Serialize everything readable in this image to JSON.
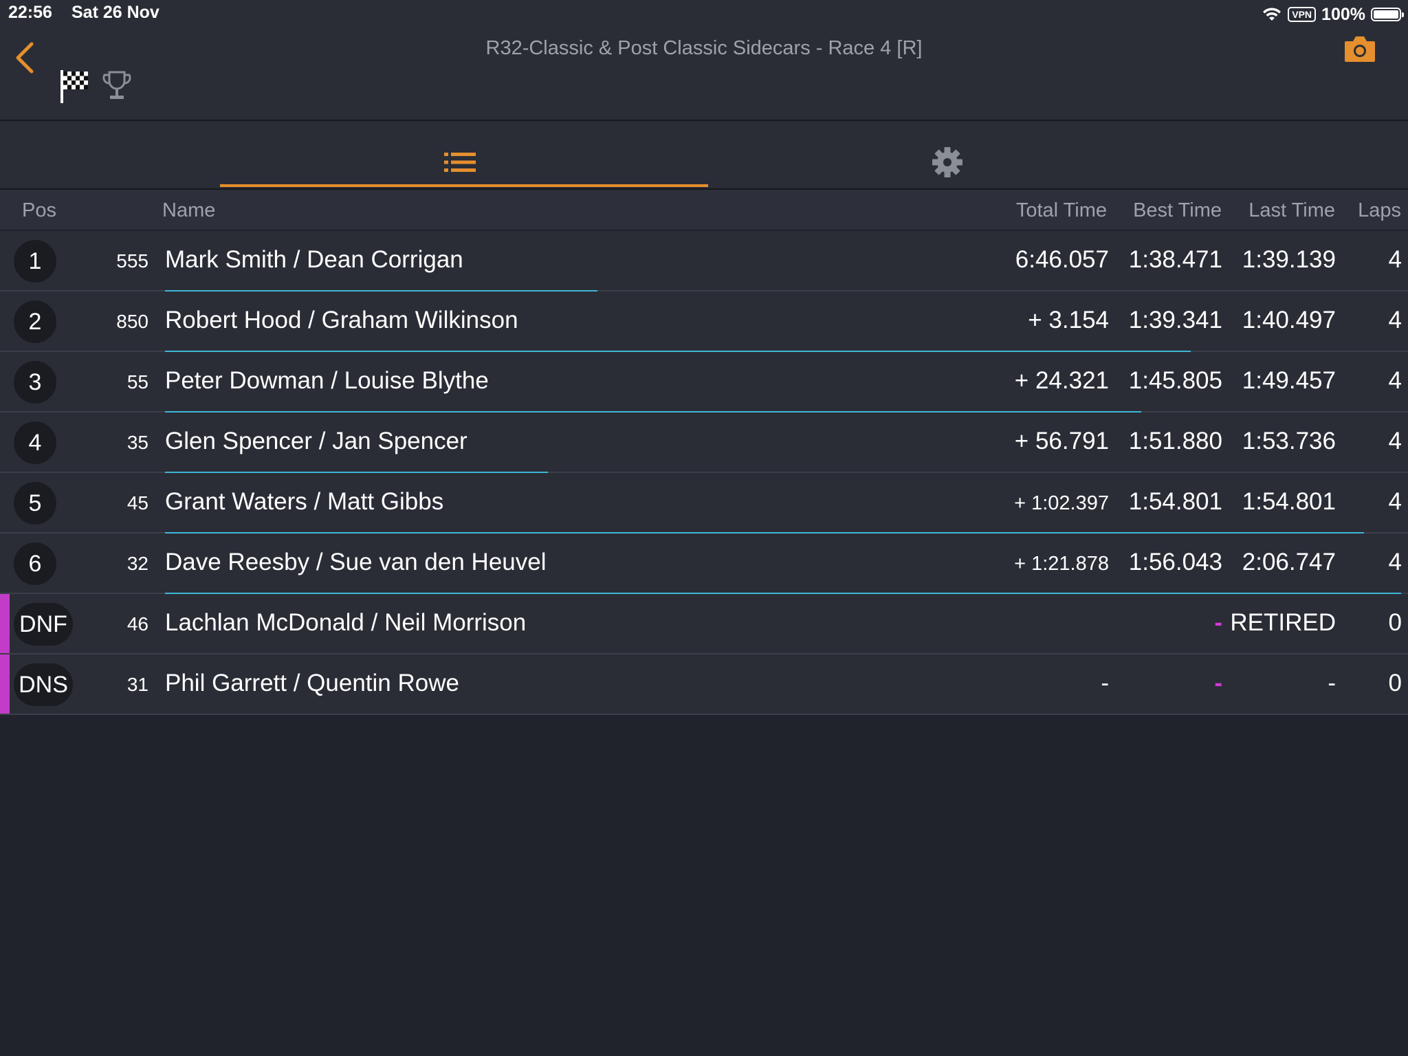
{
  "status_bar": {
    "time": "22:56",
    "date": "Sat 26 Nov",
    "vpn": "VPN",
    "battery": "100%"
  },
  "header": {
    "title": "R32-Classic & Post Classic Sidecars - Race 4 [R]",
    "accent_color": "#e58f2e"
  },
  "tabs": [
    {
      "icon": "list-icon",
      "selected": true
    },
    {
      "icon": "gear-icon",
      "selected": false
    }
  ],
  "columns": {
    "pos": "Pos",
    "name": "Name",
    "total": "Total Time",
    "best": "Best Time",
    "last": "Last Time",
    "laps": "Laps"
  },
  "rows": [
    {
      "pos": "1",
      "num": "555",
      "name": "Mark Smith / Dean Corrigan",
      "total": "6:46.057",
      "best": "1:38.471",
      "last": "1:39.139",
      "laps": "4",
      "progress": 0.35
    },
    {
      "pos": "2",
      "num": "850",
      "name": "Robert Hood / Graham Wilkinson",
      "total": "+ 3.154",
      "best": "1:39.341",
      "last": "1:40.497",
      "laps": "4",
      "progress": 0.83
    },
    {
      "pos": "3",
      "num": "55",
      "name": "Peter Dowman / Louise Blythe",
      "total": "+ 24.321",
      "best": "1:45.805",
      "last": "1:49.457",
      "laps": "4",
      "progress": 0.79
    },
    {
      "pos": "4",
      "num": "35",
      "name": "Glen Spencer / Jan Spencer",
      "total": "+ 56.791",
      "best": "1:51.880",
      "last": "1:53.736",
      "laps": "4",
      "progress": 0.31
    },
    {
      "pos": "5",
      "num": "45",
      "name": "Grant Waters / Matt Gibbs",
      "total": "+ 1:02.397",
      "best": "1:54.801",
      "last": "1:54.801",
      "laps": "4",
      "progress": 0.97
    },
    {
      "pos": "6",
      "num": "32",
      "name": "Dave Reesby / Sue van den Heuvel",
      "total": "+ 1:21.878",
      "best": "1:56.043",
      "last": "2:06.747",
      "laps": "4",
      "progress": 1.0
    },
    {
      "pos": "DNF",
      "num": "46",
      "name": "Lachlan McDonald / Neil Morrison",
      "total": "",
      "best": "-",
      "last": "RETIRED",
      "laps": "0"
    },
    {
      "pos": "DNS",
      "num": "31",
      "name": "Phil Garrett / Quentin Rowe",
      "total": "-",
      "best": "-",
      "last": "-",
      "laps": "0"
    }
  ]
}
